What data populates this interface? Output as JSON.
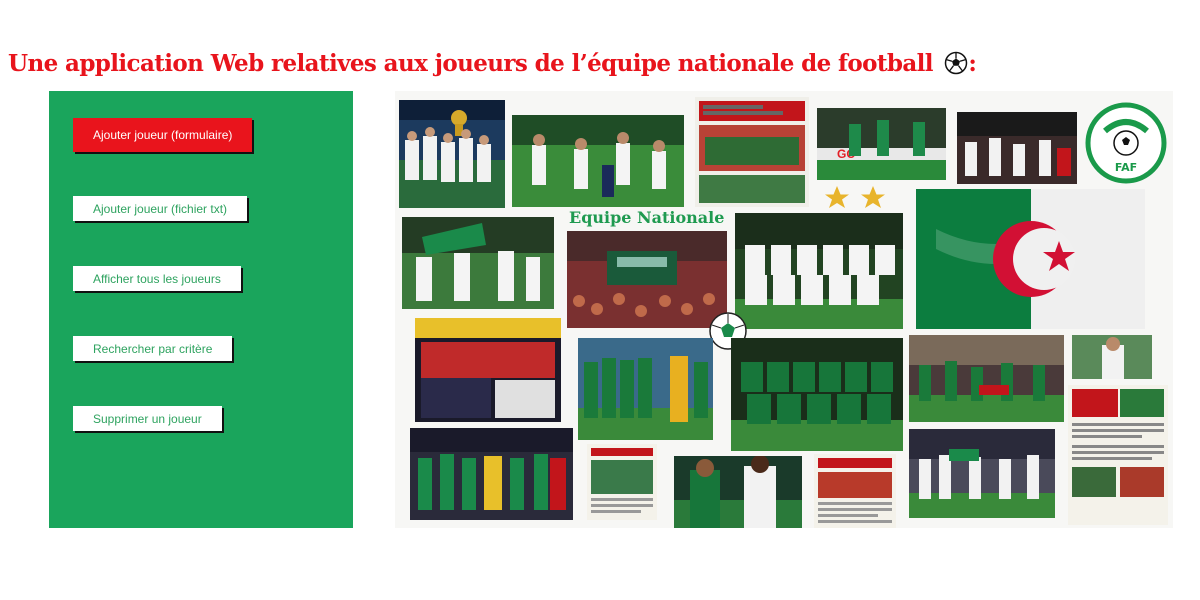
{
  "page": {
    "title": "Une application Web relatives aux joueurs de l’équipe nationale de football",
    "title_suffix": ":",
    "title_icon": "soccer-ball-icon"
  },
  "colors": {
    "title_red": "#e8141c",
    "sidebar_green": "#1aa55c",
    "active_button_red": "#e9141c",
    "button_text_green": "#2ea35f"
  },
  "menu": {
    "items": [
      {
        "label": "Ajouter joueur (formulaire)",
        "active": true
      },
      {
        "label": "Ajouter joueur (fichier txt)",
        "active": false
      },
      {
        "label": "Afficher tous les joueurs",
        "active": false
      },
      {
        "label": "Rechercher par critère",
        "active": false
      },
      {
        "label": "Supprimer un joueur",
        "active": false
      }
    ]
  },
  "collage": {
    "label": "Equipe Nationale",
    "items": [
      "trophy-celebration-photo",
      "players-running-photo",
      "newspaper-front-page",
      "players-match-photo",
      "team-celebration-photo",
      "faf-logo",
      "two-stars-icon",
      "players-with-flag-photo",
      "fans-crowd-bus-photo",
      "team-lineup-photo",
      "algerian-flag-image",
      "newspaper-headline-photo",
      "soccer-ball-icon",
      "team-with-goalkeeper-photo",
      "team-lineup-green-photo",
      "stadium-celebration-photo",
      "player-portrait-photo",
      "team-celebration-trophy-photo",
      "newspaper-article-page",
      "players-match-photo-2",
      "newspaper-fans-page",
      "players-celebration-photo",
      "newspaper-sports-page"
    ]
  }
}
